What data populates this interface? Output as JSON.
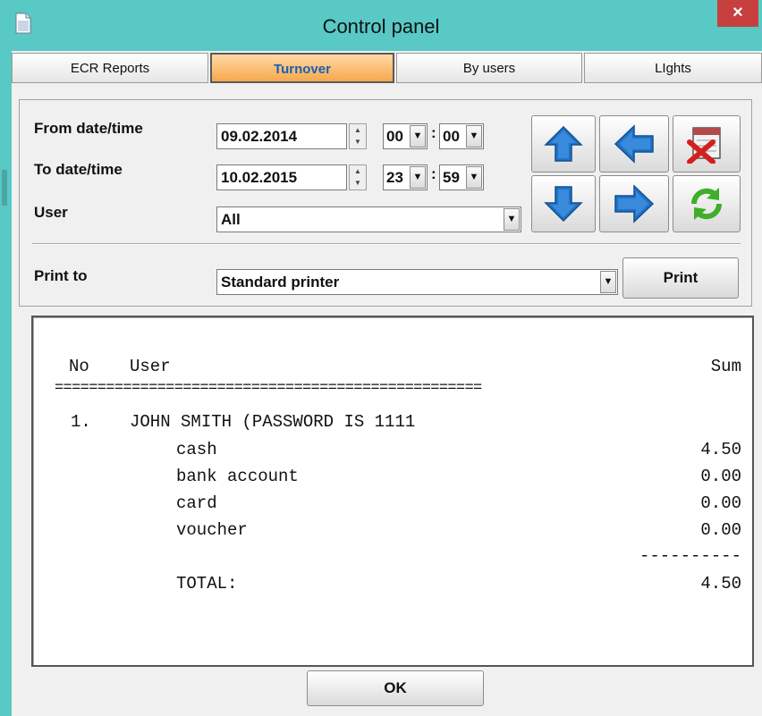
{
  "window": {
    "title": "Control panel",
    "close_label": "×"
  },
  "tabs": [
    {
      "label": "ECR Reports",
      "active": false
    },
    {
      "label": "Turnover",
      "active": true
    },
    {
      "label": "By users",
      "active": false
    },
    {
      "label": "LIghts",
      "active": false
    }
  ],
  "filters": {
    "from_label": "From date/time",
    "from_date": "09.02.2014",
    "from_hour": "00",
    "from_minute": "00",
    "to_label": "To date/time",
    "to_date": "10.02.2015",
    "to_hour": "23",
    "to_minute": "59",
    "time_separator": ":",
    "user_label": "User",
    "user_value": "All"
  },
  "print": {
    "label": "Print to",
    "printer": "Standard printer",
    "button_label": "Print"
  },
  "nav_buttons": [
    "arrow-up-icon",
    "arrow-left-icon",
    "calendar-delete-icon",
    "arrow-down-icon",
    "arrow-right-icon",
    "refresh-icon"
  ],
  "report": {
    "header_no": "No",
    "header_user": "User",
    "header_sum": "Sum",
    "double_rule": "==================================================",
    "entry_no": "1.",
    "entry_name": "JOHN SMITH (PASSWORD IS 1111",
    "rows": [
      {
        "label": "cash",
        "value": "4.50"
      },
      {
        "label": "bank account",
        "value": "0.00"
      },
      {
        "label": "card",
        "value": "0.00"
      },
      {
        "label": "voucher",
        "value": "0.00"
      }
    ],
    "single_rule": "----------",
    "total_label": "TOTAL:",
    "total_value": "4.50"
  },
  "ok_label": "OK",
  "colors": {
    "title_bar": "#58c9c5",
    "close": "#c7403f",
    "active_tab": "#f6a84d",
    "active_tab_text": "#1a5fb4",
    "arrow_blue": "#1e73c8"
  }
}
